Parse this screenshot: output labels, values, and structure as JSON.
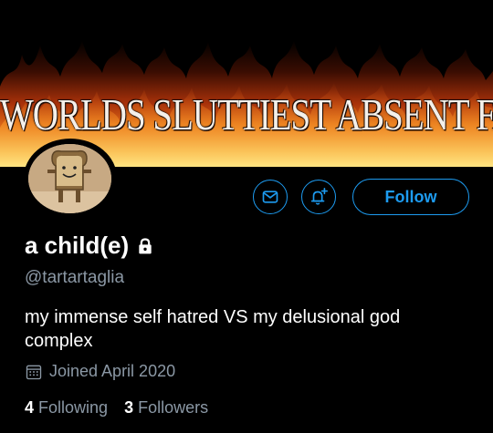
{
  "banner": {
    "text": "WORLDS SLUTTIEST ABSENT FATHER"
  },
  "profile": {
    "display_name": "a child(e)",
    "handle": "@tartartaglia",
    "bio": "my immense self hatred VS my delusional god complex",
    "joined": "Joined April 2020",
    "protected": true
  },
  "actions": {
    "follow_label": "Follow",
    "message_icon": "envelope-icon",
    "notify_icon": "bell-plus-icon"
  },
  "stats": {
    "following_count": "4",
    "following_label": "Following",
    "followers_count": "3",
    "followers_label": "Followers"
  },
  "colors": {
    "accent": "#1d9bf0",
    "secondary_text": "#8b98a5",
    "background": "#000000"
  }
}
